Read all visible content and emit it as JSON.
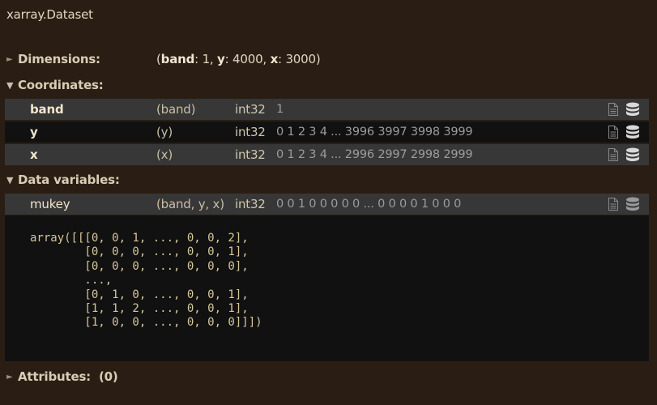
{
  "title": "xarray.Dataset",
  "dimensions": {
    "label": "Dimensions:",
    "open_paren": "(",
    "items": [
      {
        "name": "band",
        "sep": ": ",
        "value": "1",
        "after": ", "
      },
      {
        "name": "y",
        "sep": ": ",
        "value": "4000",
        "after": ", "
      },
      {
        "name": "x",
        "sep": ": ",
        "value": "3000",
        "after": ""
      }
    ],
    "close_paren": ")"
  },
  "coordinates": {
    "label": "Coordinates:",
    "rows": [
      {
        "name": "band",
        "dims": "(band)",
        "dtype": "int32",
        "preview": "1"
      },
      {
        "name": "y",
        "dims": "(y)",
        "dtype": "int32",
        "preview": "0 1 2 3 4 ... 3996 3997 3998 3999"
      },
      {
        "name": "x",
        "dims": "(x)",
        "dtype": "int32",
        "preview": "0 1 2 3 4 ... 2996 2997 2998 2999"
      }
    ]
  },
  "data_variables": {
    "label": "Data variables:",
    "rows": [
      {
        "name": "mukey",
        "dims": "(band, y, x)",
        "dtype": "int32",
        "preview": "0 0 1 0 0 0 0 0 ... 0 0 0 0 1 0 0 0"
      }
    ],
    "array_repr": "array([[[0, 0, 1, ..., 0, 0, 2],\n        [0, 0, 0, ..., 0, 0, 1],\n        [0, 0, 0, ..., 0, 0, 0],\n        ...,\n        [0, 1, 0, ..., 0, 0, 1],\n        [1, 1, 2, ..., 0, 0, 1],\n        [1, 0, 0, ..., 0, 0, 0]]])"
  },
  "attributes": {
    "label": "Attributes:",
    "count": "(0)"
  },
  "icons": {
    "attrs": "file-text-icon",
    "data": "database-icon"
  },
  "colors": {
    "background": "#2a1e14",
    "row_light": "#373737",
    "row_dark": "#111111",
    "array_text": "#d6c79a",
    "preview_text": "#9c9c9c"
  }
}
